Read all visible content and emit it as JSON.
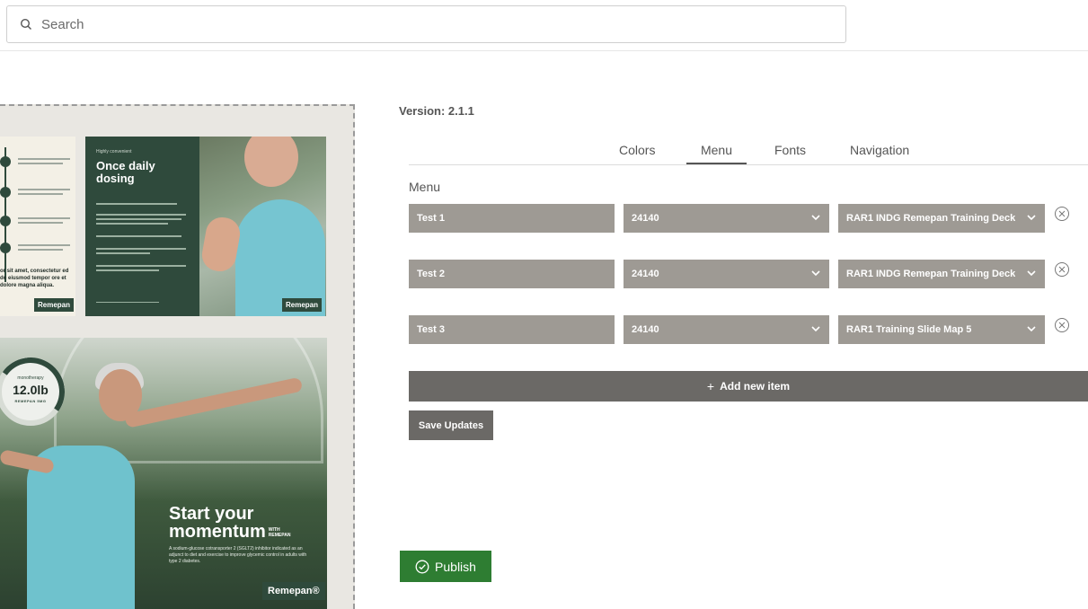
{
  "search": {
    "placeholder": "Search"
  },
  "preview": {
    "card_left": {
      "text": "or sit amet, consectetur ed do eiusmod tempor ore et dolore magna aliqua.",
      "logo": "Remepan"
    },
    "card_mid": {
      "kicker": "Highly convenient",
      "heading": "Once daily dosing",
      "logo": "Remepan"
    },
    "card_main": {
      "gauge_top": "monotherapy",
      "gauge_value": "12.0lb",
      "gauge_bottom": "REMEPAN 5MG",
      "headline_line1": "Start your",
      "headline_line2": "momentum",
      "headline_with": "WITH REMEPAN",
      "subtext": "A sodium-glucose cotransporter 2 (SGLT2) inhibitor indicated as an adjunct to diet and exercise to improve glycemic control in adults with type 2 diabetes.",
      "brand": "Remepan®"
    }
  },
  "version": "Version: 2.1.1",
  "tabs": [
    {
      "label": "Colors",
      "active": false
    },
    {
      "label": "Menu",
      "active": true
    },
    {
      "label": "Fonts",
      "active": false
    },
    {
      "label": "Navigation",
      "active": false
    }
  ],
  "section_label": "Menu",
  "menu_items": [
    {
      "name": "Test 1",
      "id": "24140",
      "target": "RAR1 INDG Remepan Training Deck"
    },
    {
      "name": "Test 2",
      "id": "24140",
      "target": "RAR1 INDG Remepan Training Deck"
    },
    {
      "name": "Test 3",
      "id": "24140",
      "target": "RAR1 Training Slide Map 5"
    }
  ],
  "add_item_label": "Add new item",
  "save_label": "Save Updates",
  "publish_label": "Publish",
  "colors": {
    "field_bg": "#9e9a94",
    "dark_btn": "#6b6966",
    "publish": "#2e7d32",
    "brand_green": "#2f4a3c"
  }
}
